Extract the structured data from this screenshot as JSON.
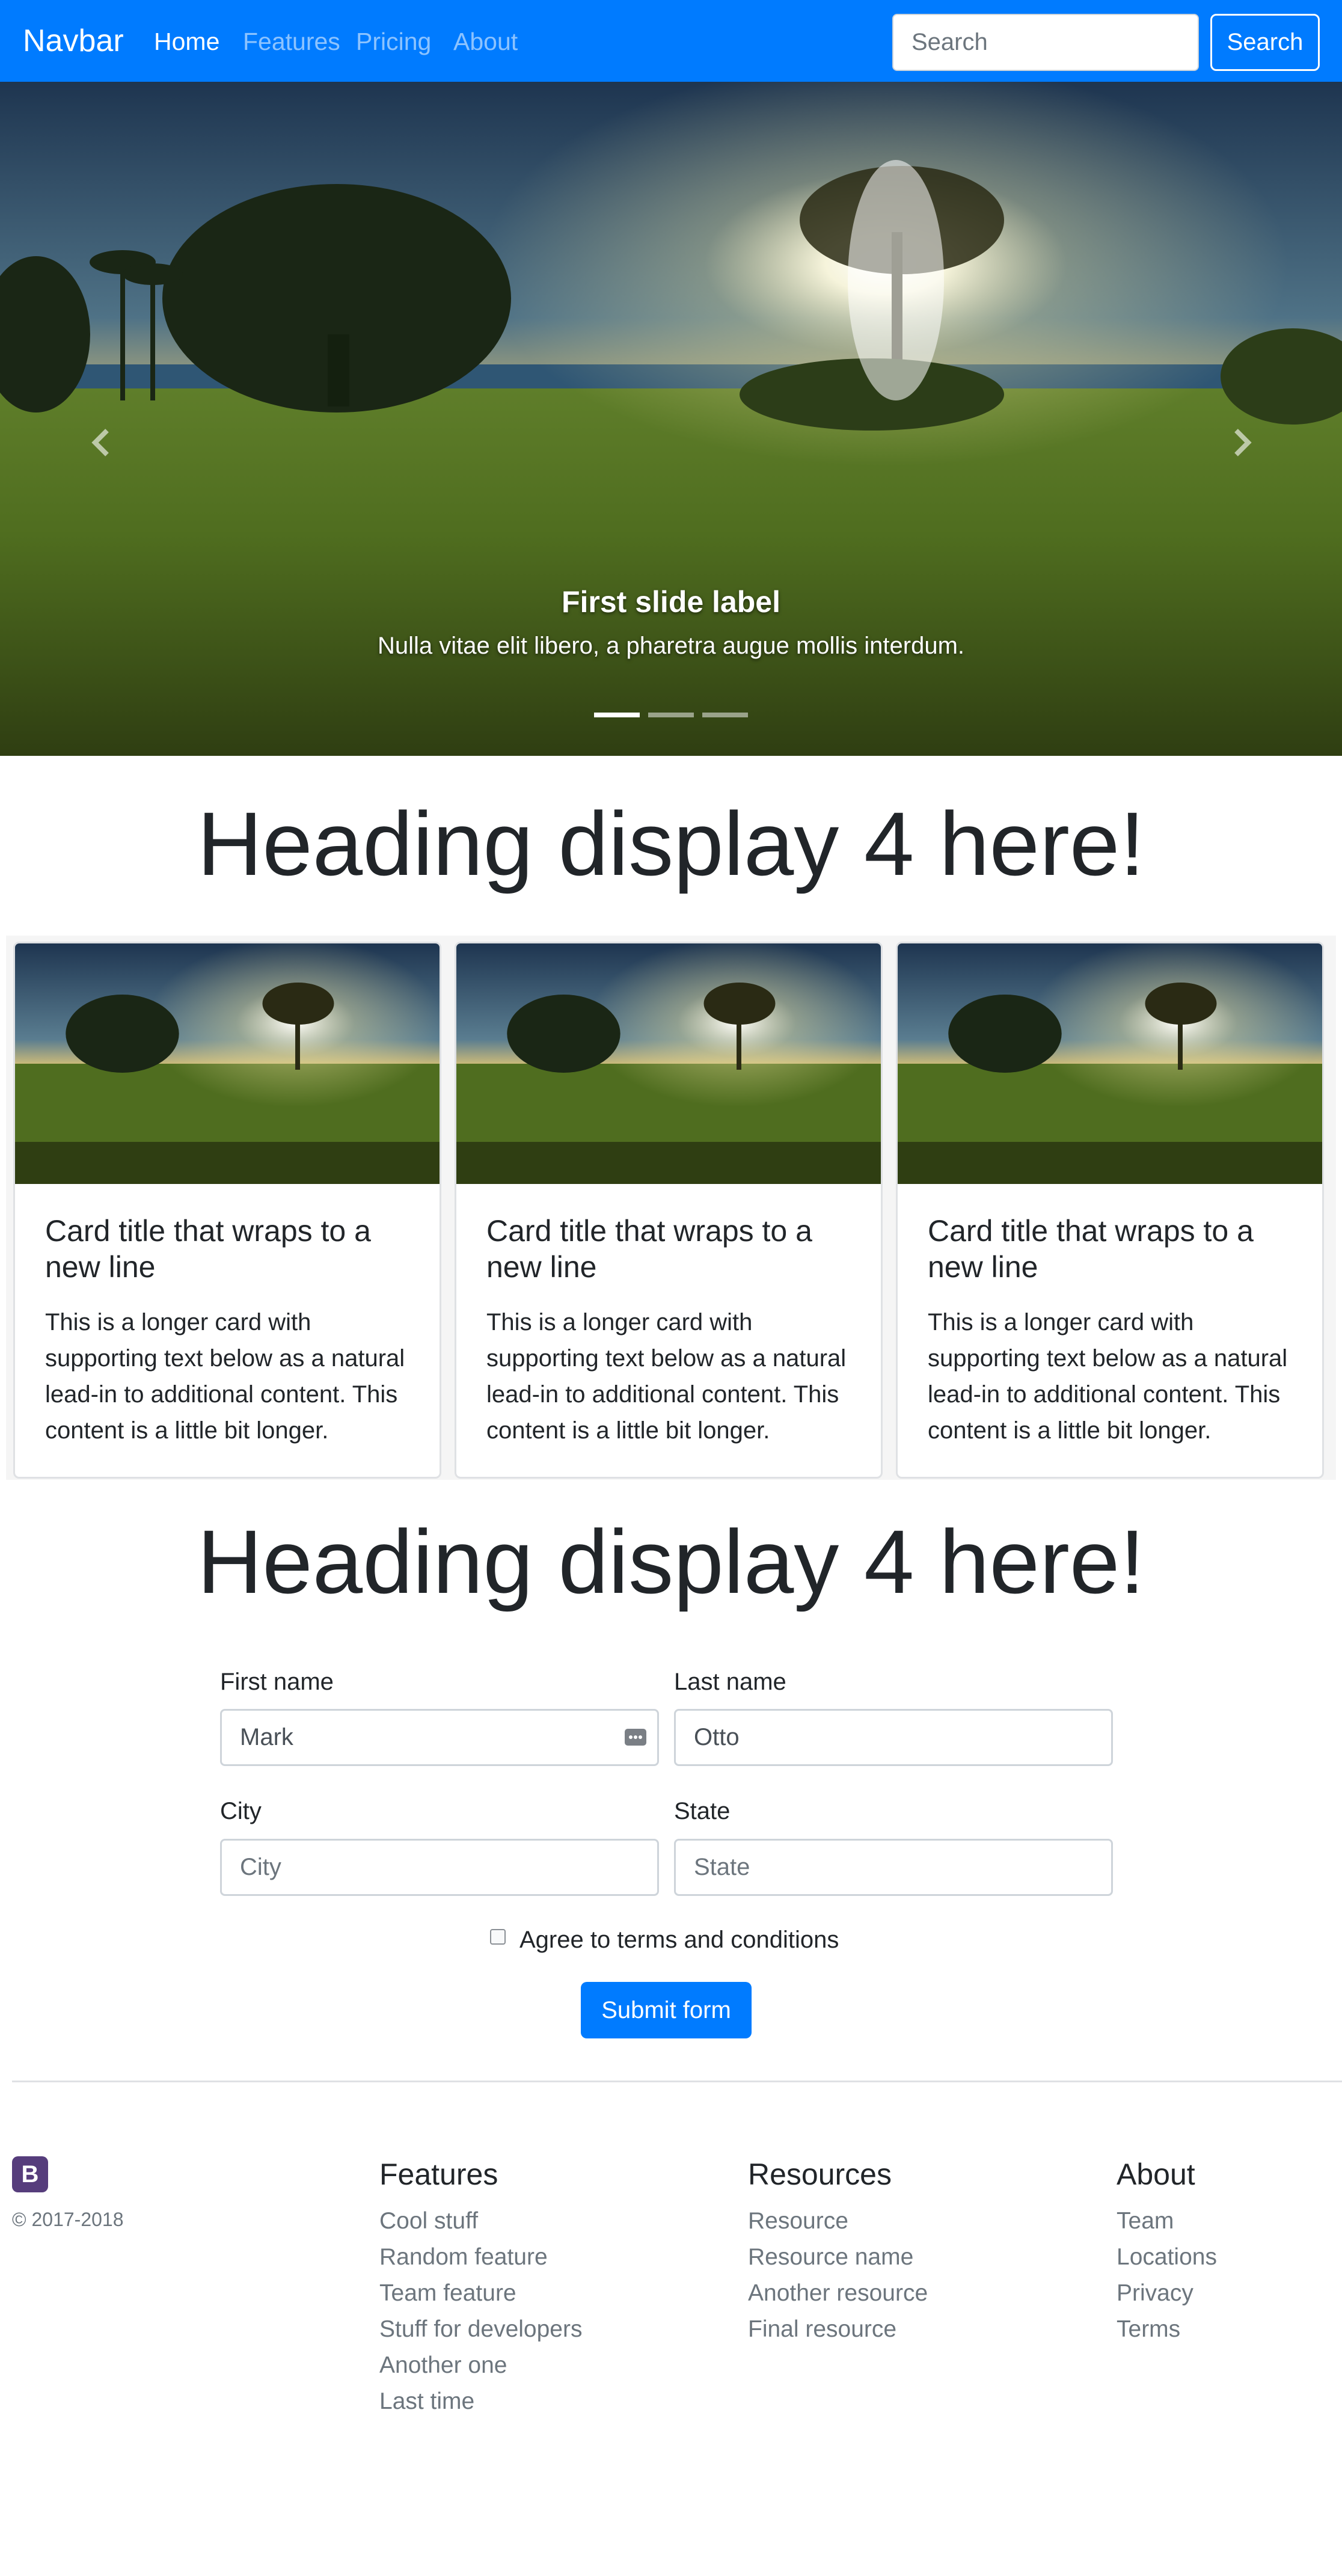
{
  "navbar": {
    "brand": "Navbar",
    "links": [
      "Home",
      "Features",
      "Pricing",
      "About"
    ],
    "search_placeholder": "Search",
    "search_button": "Search",
    "bg_color": "#007bff"
  },
  "carousel": {
    "caption_title": "First slide label",
    "caption_text": "Nulla vitae elit libero, a pharetra augue mollis interdum.",
    "slide_count": 3,
    "active_slide": 1,
    "prev_icon": "chevron-left-icon",
    "next_icon": "chevron-right-icon"
  },
  "section1": {
    "heading": "Heading display 4 here!"
  },
  "cards": [
    {
      "title": "Card title that wraps to a new line",
      "text": "This is a longer card with supporting text below as a natural lead-in to additional content. This content is a little bit longer."
    },
    {
      "title": "Card title that wraps to a new line",
      "text": "This is a longer card with supporting text below as a natural lead-in to additional content. This content is a little bit longer."
    },
    {
      "title": "Card title that wraps to a new line",
      "text": "This is a longer card with supporting text below as a natural lead-in to additional content. This content is a little bit longer."
    }
  ],
  "section2": {
    "heading": "Heading display 4 here!"
  },
  "form": {
    "first_name_label": "First name",
    "first_name_value": "Mark",
    "last_name_label": "Last name",
    "last_name_value": "Otto",
    "city_label": "City",
    "city_placeholder": "City",
    "state_label": "State",
    "state_placeholder": "State",
    "agree_label": "Agree to terms and conditions",
    "submit_label": "Submit form"
  },
  "footer": {
    "logo_letter": "B",
    "copyright": "© 2017-2018",
    "columns": [
      {
        "heading": "Features",
        "links": [
          "Cool stuff",
          "Random feature",
          "Team feature",
          "Stuff for developers",
          "Another one",
          "Last time"
        ]
      },
      {
        "heading": "Resources",
        "links": [
          "Resource",
          "Resource name",
          "Another resource",
          "Final resource"
        ]
      },
      {
        "heading": "About",
        "links": [
          "Team",
          "Locations",
          "Privacy",
          "Terms"
        ]
      }
    ]
  }
}
